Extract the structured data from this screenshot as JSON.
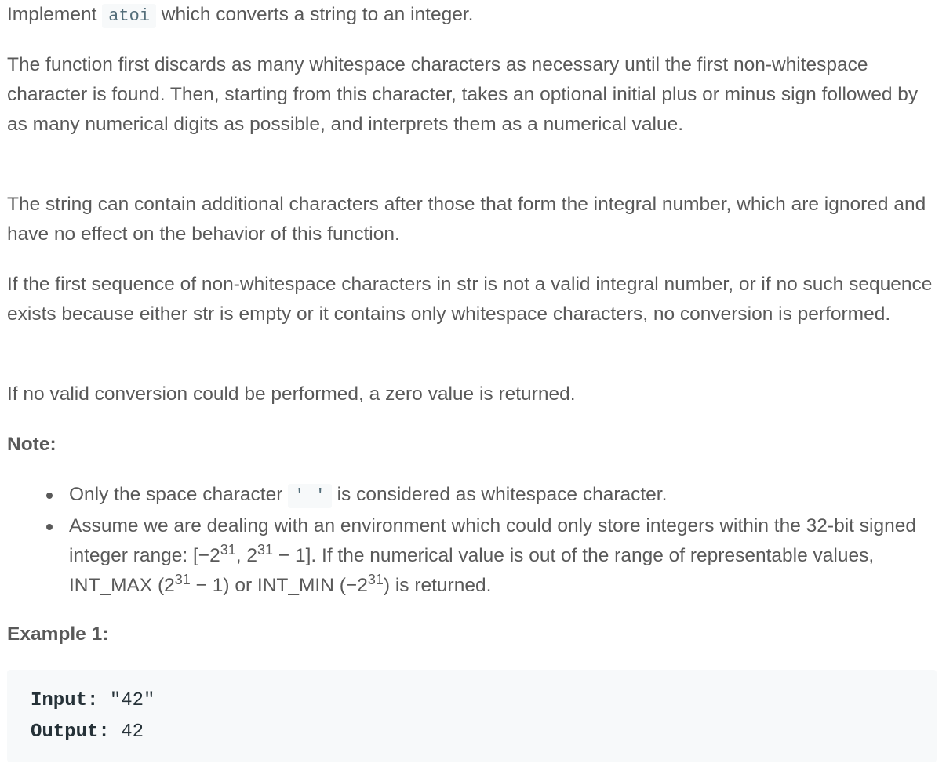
{
  "intro": {
    "before": "Implement ",
    "code": "atoi",
    "after": " which converts a string to an integer."
  },
  "paragraph2": "The function first discards as many whitespace characters as necessary until the first non-whitespace character is found. Then, starting from this character, takes an optional initial plus or minus sign followed by as many numerical digits as possible, and interprets them as a numerical value.",
  "paragraph3": "The string can contain additional characters after those that form the integral number, which are ignored and have no effect on the behavior of this function.",
  "paragraph4": "If the first sequence of non-whitespace characters in str is not a valid integral number, or if no such sequence exists because either str is empty or it contains only whitespace characters, no conversion is performed.",
  "paragraph5": "If no valid conversion could be performed, a zero value is returned.",
  "note_heading": "Note:",
  "notes": {
    "item1": {
      "before": "Only the space character ",
      "code": "' '",
      "after": " is considered as whitespace character."
    },
    "item2": {
      "t1": "Assume we are dealing with an environment which could only store integers within the 32-bit signed integer range: [−2",
      "s1": "31",
      "t2": ",  2",
      "s2": "31",
      "t3": " − 1]. If the numerical value is out of the range of representable values, INT_MAX (2",
      "s3": "31",
      "t4": " − 1) or INT_MIN (−2",
      "s4": "31",
      "t5": ") is returned."
    }
  },
  "example1": {
    "heading": "Example 1:",
    "input_label": "Input:",
    "input_value": " \"42\"",
    "output_label": "Output:",
    "output_value": " 42"
  }
}
